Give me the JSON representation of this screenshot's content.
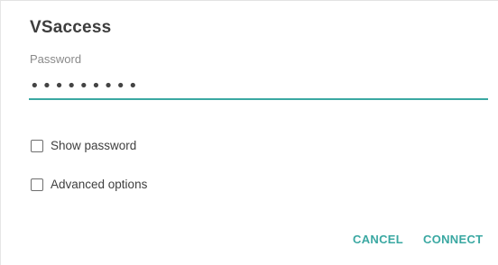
{
  "dialog": {
    "network_name": "VSaccess",
    "password_label": "Password",
    "password_value": "•••••••••",
    "show_password_label": "Show password",
    "show_password_checked": false,
    "advanced_options_label": "Advanced options",
    "advanced_options_checked": false,
    "cancel_label": "CANCEL",
    "connect_label": "CONNECT"
  },
  "colors": {
    "accent": "#3aa8a2",
    "title": "#3d3d3d",
    "label": "#8a8a8a"
  }
}
